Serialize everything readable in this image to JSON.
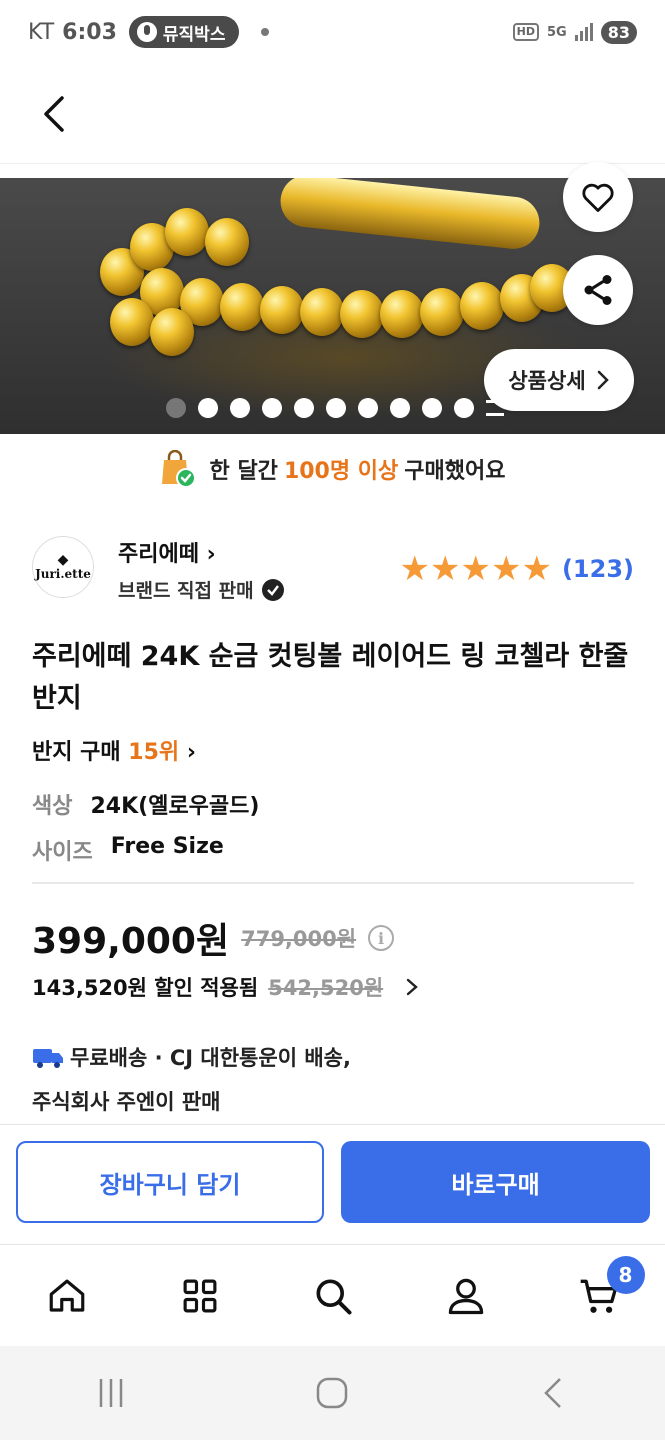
{
  "status_bar": {
    "carrier": "KT",
    "time": "6:03",
    "pill_label": "뮤직박스",
    "network_hd": "HD",
    "network_type": "5G",
    "battery": "83"
  },
  "product": {
    "detail_button_label": "상품상세",
    "image_count": 11,
    "active_image_index": 0
  },
  "notice": {
    "prefix": "한 달간",
    "highlight": "100명 이상",
    "suffix": "구매했어요"
  },
  "seller": {
    "logo_text": "Juri.ette",
    "name": "주리에떼",
    "subtitle": "브랜드 직접 판매",
    "rating_stars": 5,
    "review_count": "(123)"
  },
  "title": "주리에떼 24K 순금 컷팅볼 레이어드 링 코첼라 한줄 반지",
  "rank": {
    "label": "반지 구매",
    "value": "15위"
  },
  "options": [
    {
      "key": "색상",
      "value": "24K(옐로우골드)"
    },
    {
      "key": "사이즈",
      "value": "Free Size"
    }
  ],
  "price": {
    "sale": "399,000원",
    "original": "779,000원",
    "discount_text": "143,520원 할인 적용됨",
    "discount_original": "542,520원"
  },
  "shipping": {
    "line1": "무료배송 · CJ 대한통운이 배송,",
    "line2": "주식회사 주엔이 판매"
  },
  "actions": {
    "cart": "장바구니 담기",
    "buy": "바로구매"
  },
  "bottom_nav": {
    "cart_badge": "8",
    "items": [
      "home-icon",
      "category-icon",
      "search-icon",
      "user-icon",
      "cart-icon"
    ]
  },
  "colors": {
    "accent": "#3a6ee8",
    "highlight": "#e8741a",
    "star": "#f59a37"
  }
}
